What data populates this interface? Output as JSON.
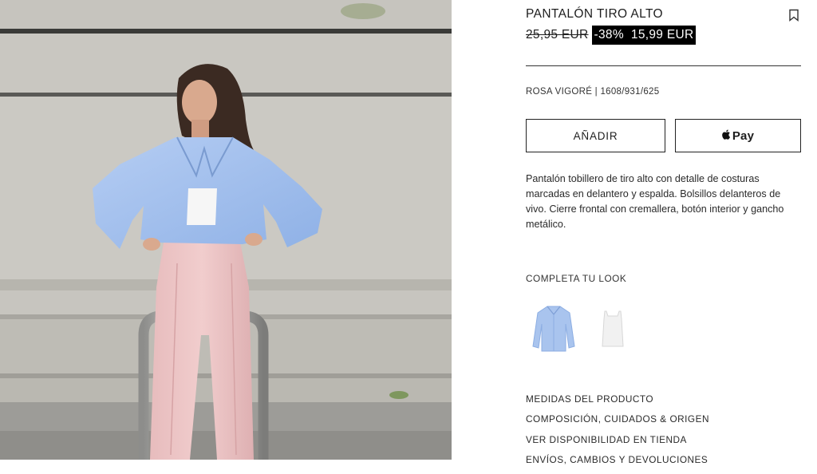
{
  "product": {
    "title": "PANTALÓN TIRO ALTO",
    "old_price": "25,95 EUR",
    "discount": "-38%",
    "sale_price": "15,99 EUR",
    "color_ref": "ROSA VIGORÉ | 1608/931/625",
    "description": "Pantalón tobillero de tiro alto con detalle de costuras marcadas en delantero y espalda. Bolsillos delanteros de vivo. Cierre frontal con cremallera, botón interior y gancho metálico."
  },
  "actions": {
    "add_label": "AÑADIR",
    "pay_label": "Pay",
    "bookmark_icon": "bookmark-icon",
    "apple_icon": "apple-logo-icon"
  },
  "look": {
    "heading": "COMPLETA TU LOOK",
    "items": [
      {
        "name": "blue-shirt",
        "color": "#a9c4ee"
      },
      {
        "name": "white-top",
        "color": "#f1f1f1"
      }
    ]
  },
  "links": [
    "MEDIDAS DEL PRODUCTO",
    "COMPOSICIÓN, CUIDADOS & ORIGEN",
    "VER DISPONIBILIDAD EN TIENDA",
    "ENVÍOS, CAMBIOS Y DEVOLUCIONES"
  ],
  "colors": {
    "sale_background": "#000000",
    "sale_text": "#ffffff",
    "border": "#222222"
  }
}
